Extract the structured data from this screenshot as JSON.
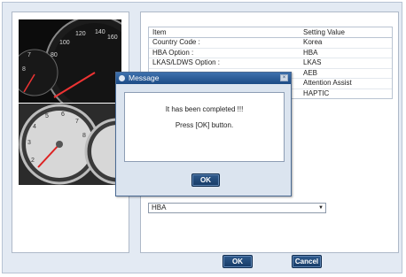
{
  "table": {
    "headers": [
      "Item",
      "Setting Value"
    ],
    "rows": [
      [
        "Country Code :",
        "Korea"
      ],
      [
        "HBA Option :",
        "HBA"
      ],
      [
        "LKAS/LDWS Option :",
        "LKAS"
      ],
      [
        "",
        "AEB"
      ],
      [
        "",
        "Attention Assist"
      ],
      [
        "",
        "HAPTIC"
      ]
    ]
  },
  "select": {
    "value": "HBA"
  },
  "buttons": {
    "ok": "OK",
    "cancel": "Cancel"
  },
  "dialog": {
    "title": "Message",
    "line1": "It has been completed !!!",
    "line2": "Press [OK] button.",
    "ok": "OK"
  },
  "colors": {
    "accent": "#1f4a80",
    "panel": "#e3eaf3"
  }
}
